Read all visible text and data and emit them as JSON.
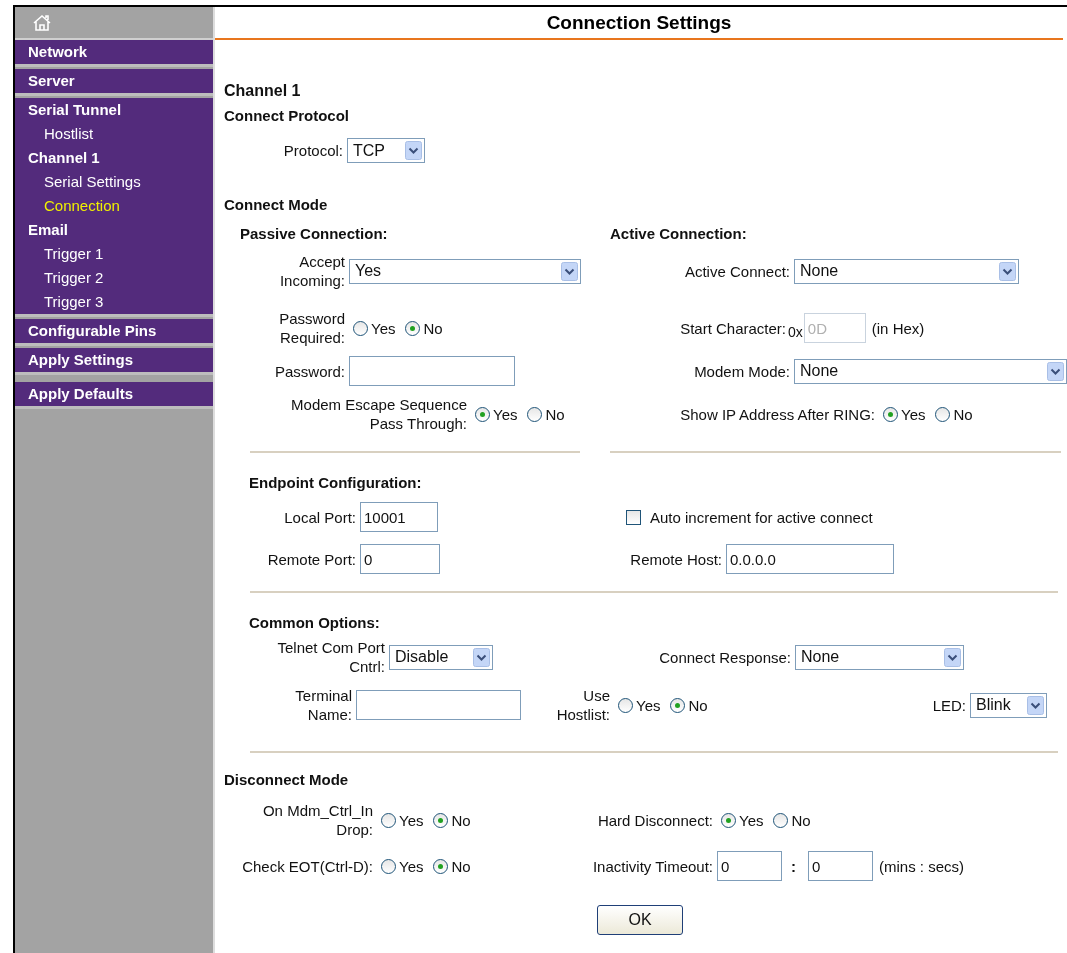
{
  "sidebar": {
    "groups": [
      {
        "items": [
          {
            "label": "Network",
            "kind": "head",
            "selected": false
          }
        ]
      },
      {
        "items": [
          {
            "label": "Server",
            "kind": "head",
            "selected": false
          }
        ]
      },
      {
        "items": [
          {
            "label": "Serial Tunnel",
            "kind": "head",
            "selected": false
          },
          {
            "label": "Hostlist",
            "kind": "sub",
            "selected": false
          },
          {
            "label": "Channel 1",
            "kind": "head",
            "selected": false
          },
          {
            "label": "Serial Settings",
            "kind": "sub",
            "selected": false
          },
          {
            "label": "Connection",
            "kind": "sub",
            "selected": true
          },
          {
            "label": "Email",
            "kind": "head",
            "selected": false
          },
          {
            "label": "Trigger 1",
            "kind": "sub",
            "selected": false
          },
          {
            "label": "Trigger 2",
            "kind": "sub",
            "selected": false
          },
          {
            "label": "Trigger 3",
            "kind": "sub",
            "selected": false
          }
        ]
      },
      {
        "items": [
          {
            "label": "Configurable Pins",
            "kind": "head",
            "selected": false
          }
        ]
      },
      {
        "items": [
          {
            "label": "Apply Settings",
            "kind": "head",
            "selected": false
          }
        ]
      },
      {
        "items": [
          {
            "label": "Apply Defaults",
            "kind": "head",
            "selected": false
          }
        ]
      }
    ]
  },
  "title": "Connection Settings",
  "channel": "Channel 1",
  "protocol": {
    "heading": "Connect Protocol",
    "fields": [
      {
        "label": "Protocol:",
        "control": {
          "kind": "select",
          "value": "TCP"
        }
      }
    ]
  },
  "connect_mode": {
    "heading": "Connect Mode",
    "passive": {
      "heading": "Passive Connection:",
      "fields": [
        {
          "label": "Accept\nIncoming:",
          "control": {
            "kind": "select",
            "value": "Yes"
          }
        },
        {
          "label": "Password\nRequired:",
          "control": {
            "kind": "radio",
            "options": [
              {
                "label": "Yes",
                "selected": false
              },
              {
                "label": "No",
                "selected": true
              }
            ]
          }
        },
        {
          "label": "Password:",
          "control": {
            "kind": "text"
          }
        },
        {
          "label": "Modem Escape Sequence\nPass Through:",
          "control": {
            "kind": "radio",
            "options": [
              {
                "label": "Yes",
                "selected": true
              },
              {
                "label": "No",
                "selected": false
              }
            ]
          }
        }
      ]
    },
    "active": {
      "heading": "Active Connection:",
      "fields": [
        {
          "label": "Active Connect:",
          "control": {
            "kind": "select",
            "value": "None"
          }
        },
        {
          "label": "Start Character:",
          "control": {
            "kind": "hex",
            "prefix": "0x",
            "value": "0D",
            "suffix": "(in Hex)",
            "disabled": true
          }
        },
        {
          "label": "Modem Mode:",
          "control": {
            "kind": "select",
            "value": "None"
          }
        },
        {
          "label": "Show IP Address After RING:",
          "control": {
            "kind": "radio",
            "options": [
              {
                "label": "Yes",
                "selected": true
              },
              {
                "label": "No",
                "selected": false
              }
            ]
          }
        }
      ]
    }
  },
  "endpoint": {
    "heading": "Endpoint Configuration:",
    "fields": [
      {
        "label": "Local Port:",
        "control": {
          "kind": "text",
          "value": "10001"
        }
      },
      {
        "control": {
          "kind": "checkbox",
          "label": "Auto increment for active connect",
          "checked": false
        }
      },
      {
        "label": "Remote Port:",
        "control": {
          "kind": "text",
          "value": "0"
        }
      },
      {
        "label": "Remote Host:",
        "control": {
          "kind": "text",
          "value": "0.0.0.0"
        }
      }
    ]
  },
  "common": {
    "heading": "Common Options:",
    "fields": [
      {
        "label": "Telnet Com Port\nCntrl:",
        "control": {
          "kind": "select",
          "value": "Disable"
        }
      },
      {
        "label": "Connect Response:",
        "control": {
          "kind": "select",
          "value": "None"
        }
      },
      {
        "label": "Terminal\nName:",
        "control": {
          "kind": "text"
        }
      },
      {
        "label": "Use\nHostlist:",
        "control": {
          "kind": "radio",
          "options": [
            {
              "label": "Yes",
              "selected": false
            },
            {
              "label": "No",
              "selected": true
            }
          ]
        }
      },
      {
        "label": "LED:",
        "control": {
          "kind": "select",
          "value": "Blink"
        }
      }
    ]
  },
  "disconnect": {
    "heading": "Disconnect Mode",
    "fields": [
      {
        "label": "On Mdm_Ctrl_In\nDrop:",
        "control": {
          "kind": "radio",
          "options": [
            {
              "label": "Yes",
              "selected": false
            },
            {
              "label": "No",
              "selected": true
            }
          ]
        }
      },
      {
        "label": "Hard Disconnect:",
        "control": {
          "kind": "radio",
          "options": [
            {
              "label": "Yes",
              "selected": true
            },
            {
              "label": "No",
              "selected": false
            }
          ]
        }
      },
      {
        "label": "Check EOT(Ctrl-D):",
        "control": {
          "kind": "radio",
          "options": [
            {
              "label": "Yes",
              "selected": false
            },
            {
              "label": "No",
              "selected": true
            }
          ]
        }
      },
      {
        "label": "Inactivity Timeout:",
        "control": {
          "kind": "timeout",
          "values": [
            "0",
            "0"
          ],
          "separator": ":",
          "suffix": "(mins : secs)"
        }
      }
    ]
  },
  "ok_button": "OK"
}
